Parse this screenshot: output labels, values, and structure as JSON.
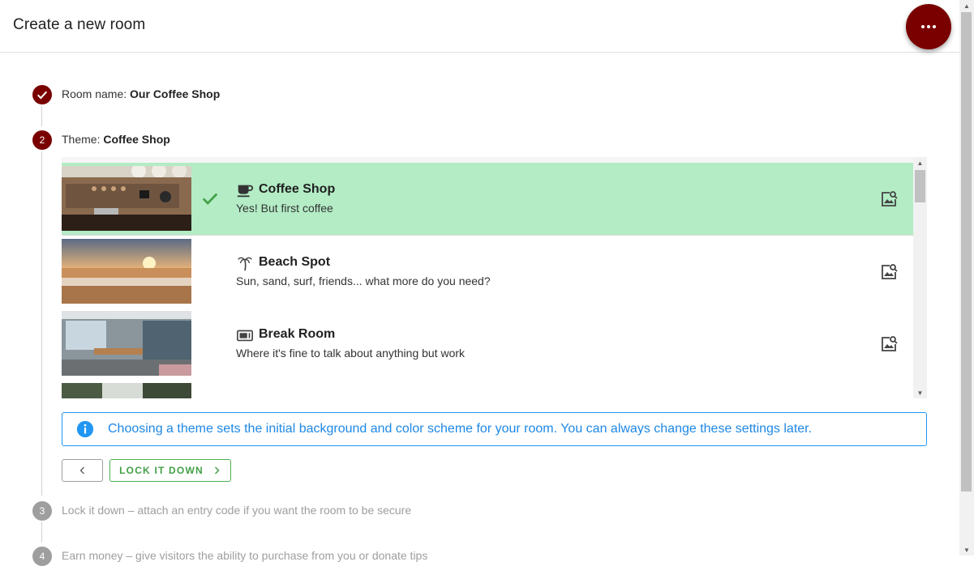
{
  "header": {
    "title": "Create a new room"
  },
  "fab": {
    "icon": "more-horiz-icon"
  },
  "steps": {
    "step1": {
      "label": "Room name: ",
      "value": "Our Coffee Shop"
    },
    "step2": {
      "number": "2",
      "label": "Theme: ",
      "value": "Coffee Shop"
    },
    "step3": {
      "number": "3",
      "label": "Lock it down – attach an entry code if you want the room to be secure"
    },
    "step4": {
      "number": "4",
      "label": "Earn money – give visitors the ability to purchase from you or donate tips"
    }
  },
  "themes": [
    {
      "title": "Coffee Shop",
      "subtitle": "Yes! But first coffee",
      "icon": "coffee-cup-icon",
      "selected": true
    },
    {
      "title": "Beach Spot",
      "subtitle": "Sun, sand, surf, friends... what more do you need?",
      "icon": "palm-tree-icon",
      "selected": false
    },
    {
      "title": "Break Room",
      "subtitle": "Where it's fine to talk about anything but work",
      "icon": "microwave-icon",
      "selected": false
    }
  ],
  "info": {
    "text": "Choosing a theme sets the initial background and color scheme for your room. You can always change these settings later."
  },
  "buttons": {
    "next_label": "LOCK IT DOWN"
  },
  "colors": {
    "accent": "#7a0000",
    "selected_row": "#b3ecc5",
    "info": "#2196f3",
    "success": "#4caf50"
  }
}
